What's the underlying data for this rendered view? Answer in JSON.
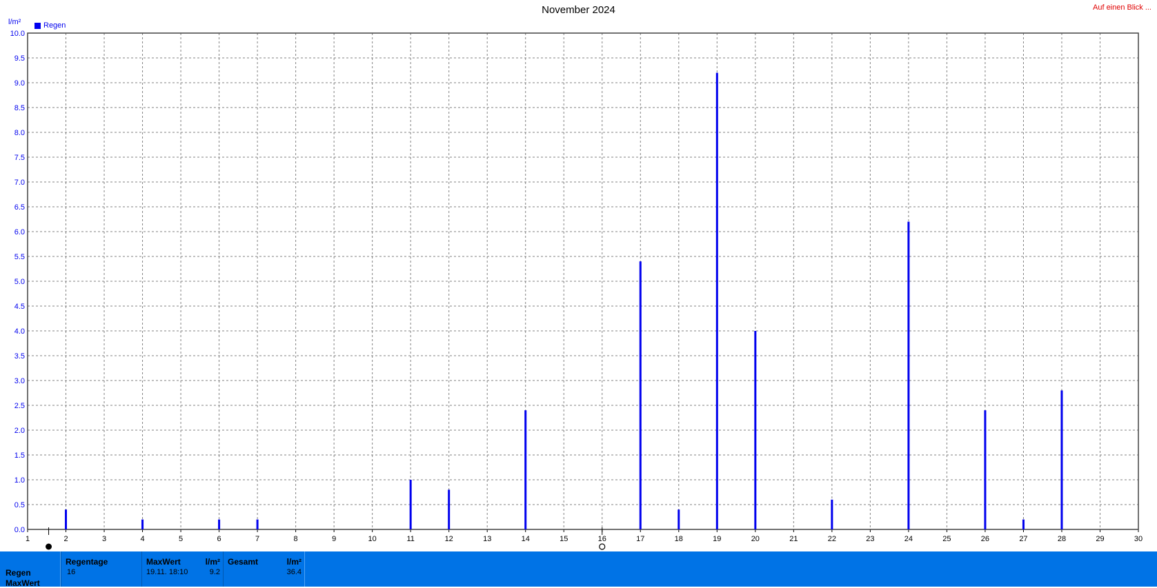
{
  "header": {
    "title": "November 2024",
    "quick_link": "Auf einen Blick ...",
    "unit": "l/m²"
  },
  "legend": {
    "label": "Regen",
    "color": "#0000ee"
  },
  "chart_data": {
    "type": "bar",
    "title": "November 2024",
    "ylabel": "l/m²",
    "xlabel": "",
    "ylim": [
      0,
      10
    ],
    "xlim": [
      1,
      30
    ],
    "y_ticks": [
      "0.0",
      "0.5",
      "1.0",
      "1.5",
      "2.0",
      "2.5",
      "3.0",
      "3.5",
      "4.0",
      "4.5",
      "5.0",
      "5.5",
      "6.0",
      "6.5",
      "7.0",
      "7.5",
      "8.0",
      "8.5",
      "9.0",
      "9.5",
      "10.0"
    ],
    "x_ticks": [
      "1",
      "2",
      "3",
      "4",
      "5",
      "6",
      "7",
      "8",
      "9",
      "10",
      "11",
      "12",
      "13",
      "14",
      "15",
      "16",
      "17",
      "18",
      "19",
      "20",
      "21",
      "22",
      "23",
      "24",
      "25",
      "26",
      "27",
      "28",
      "29",
      "30"
    ],
    "grid": true,
    "legend_position": "top-left",
    "series": [
      {
        "name": "Regen",
        "color": "#0000ee",
        "x": [
          2,
          4,
          6,
          7,
          11,
          12,
          14,
          17,
          18,
          19,
          20,
          22,
          24,
          26,
          27,
          28
        ],
        "values": [
          0.4,
          0.2,
          0.2,
          0.2,
          1.0,
          0.8,
          2.4,
          5.4,
          0.4,
          9.2,
          4.0,
          0.6,
          6.2,
          2.4,
          0.2,
          2.8
        ]
      }
    ],
    "markers": [
      {
        "x": 1.55,
        "symbol": "filled-circle"
      },
      {
        "x": 16,
        "symbol": "open-circle"
      }
    ]
  },
  "footer": {
    "row_labels": [
      "Regen",
      "MaxWert"
    ],
    "regentage": {
      "header": "Regentage",
      "value": "16"
    },
    "maxwert": {
      "header": "MaxWert",
      "unit": "l/m²",
      "datetime": "19.11.  18:10",
      "value": "9.2"
    },
    "gesamt": {
      "header": "Gesamt",
      "unit": "l/m²",
      "value": "36.4"
    }
  }
}
